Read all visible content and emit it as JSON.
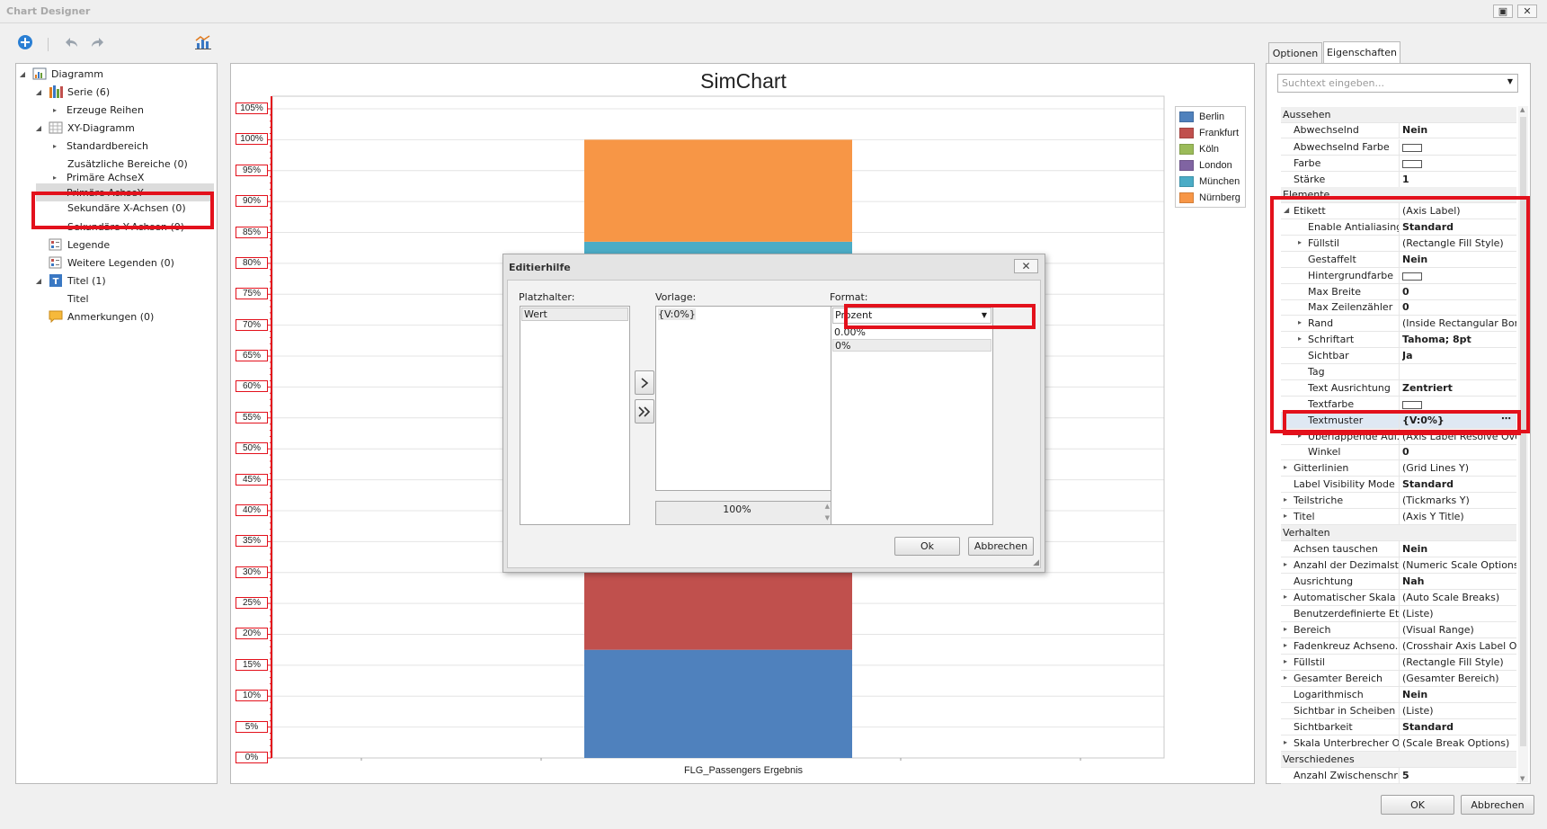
{
  "window": {
    "title": "Chart Designer"
  },
  "tree": {
    "items": [
      {
        "label": "Diagramm"
      },
      {
        "label": "Serie (6)"
      },
      {
        "label": "Erzeuge Reihen"
      },
      {
        "label": "XY-Diagramm"
      },
      {
        "label": "Standardbereich"
      },
      {
        "label": "Zusätzliche Bereiche (0)"
      },
      {
        "label": "Primäre AchseX"
      },
      {
        "label": "Primäre AchseY"
      },
      {
        "label": "Sekundäre X-Achsen (0)"
      },
      {
        "label": "Sekundäre Y-Achsen (0)"
      },
      {
        "label": "Legende"
      },
      {
        "label": "Weitere Legenden (0)"
      },
      {
        "label": "Titel (1)"
      },
      {
        "label": "Titel"
      },
      {
        "label": "Anmerkungen (0)"
      }
    ]
  },
  "chart_data": {
    "type": "bar",
    "title": "SimChart",
    "xlabel": "FLG_Passengers Ergebnis",
    "ylabel": "",
    "categories": [
      "FLG_Passengers Ergebnis"
    ],
    "stacked": true,
    "ylim": [
      0,
      105
    ],
    "yticks": [
      "0%",
      "5%",
      "10%",
      "15%",
      "20%",
      "25%",
      "30%",
      "35%",
      "40%",
      "45%",
      "50%",
      "55%",
      "60%",
      "65%",
      "70%",
      "75%",
      "80%",
      "85%",
      "90%",
      "95%",
      "100%",
      "105%"
    ],
    "series": [
      {
        "name": "Berlin",
        "color": "#4f81bd",
        "values": [
          17.5
        ]
      },
      {
        "name": "Frankfurt",
        "color": "#c0504d",
        "values": [
          12.5
        ]
      },
      {
        "name": "Köln",
        "color": "#9bbb59",
        "values": [
          0
        ]
      },
      {
        "name": "London",
        "color": "#8064a2",
        "values": [
          0
        ]
      },
      {
        "name": "München",
        "color": "#4bacc6",
        "values": [
          53.5
        ]
      },
      {
        "name": "Nürnberg",
        "color": "#f79646",
        "values": [
          16.5
        ]
      }
    ],
    "legend_position": "top-right"
  },
  "dialog": {
    "title": "Editierhilfe",
    "platzhalter_label": "Platzhalter:",
    "platzhalter_items": [
      "Wert"
    ],
    "vorlage_label": "Vorlage:",
    "vorlage_value": "{V:0%}",
    "preview_value": "100%",
    "format_label": "Format:",
    "format_selected": "Prozent",
    "format_options": [
      "0.00%",
      "0%"
    ],
    "ok_label": "Ok",
    "cancel_label": "Abbrechen"
  },
  "tabs": {
    "optionen": "Optionen",
    "eigenschaften": "Eigenschaften"
  },
  "search": {
    "placeholder": "Suchtext eingeben..."
  },
  "properties": [
    {
      "name": "Aussehen",
      "value": "",
      "type": "cat"
    },
    {
      "name": "Abwechselnd",
      "value": "Nein",
      "bold": true
    },
    {
      "name": "Abwechselnd Farbe",
      "value": "",
      "color": true
    },
    {
      "name": "Farbe",
      "value": "",
      "color": true
    },
    {
      "name": "Stärke",
      "value": "1",
      "bold": true
    },
    {
      "name": "Elemente",
      "value": "",
      "type": "cat"
    },
    {
      "name": "Etikett",
      "value": "(Axis Label)",
      "exp": "open"
    },
    {
      "name": "Enable Antialiasing",
      "value": "Standard",
      "bold": true,
      "indent": 2
    },
    {
      "name": "Füllstil",
      "value": "(Rectangle Fill Style)",
      "indent": 2,
      "exp": "closed"
    },
    {
      "name": "Gestaffelt",
      "value": "Nein",
      "bold": true,
      "indent": 2
    },
    {
      "name": "Hintergrundfarbe",
      "value": "",
      "color": true,
      "indent": 2
    },
    {
      "name": "Max Breite",
      "value": "0",
      "bold": true,
      "indent": 2
    },
    {
      "name": "Max Zeilenzähler",
      "value": "0",
      "bold": true,
      "indent": 2
    },
    {
      "name": "Rand",
      "value": "(Inside Rectangular Borde",
      "indent": 2,
      "exp": "closed"
    },
    {
      "name": "Schriftart",
      "value": "Tahoma; 8pt",
      "bold": true,
      "indent": 2,
      "exp": "closed"
    },
    {
      "name": "Sichtbar",
      "value": "Ja",
      "bold": true,
      "indent": 2
    },
    {
      "name": "Tag",
      "value": "",
      "indent": 2
    },
    {
      "name": "Text Ausrichtung",
      "value": "Zentriert",
      "bold": true,
      "indent": 2
    },
    {
      "name": "Textfarbe",
      "value": "",
      "color": true,
      "indent": 2
    },
    {
      "name": "Textmuster",
      "value": "{V:0%}",
      "bold": true,
      "indent": 2,
      "selected": true
    },
    {
      "name": "Überlappende Auf...",
      "value": "(Axis Label Resolve Over...",
      "indent": 2,
      "exp": "closed"
    },
    {
      "name": "Winkel",
      "value": "0",
      "bold": true,
      "indent": 2
    },
    {
      "name": "Gitterlinien",
      "value": "(Grid Lines Y)",
      "exp": "closed"
    },
    {
      "name": "Label Visibility Mode",
      "value": "Standard",
      "bold": true
    },
    {
      "name": "Teilstriche",
      "value": "(Tickmarks Y)",
      "exp": "closed"
    },
    {
      "name": "Titel",
      "value": "(Axis Y Title)",
      "exp": "closed"
    },
    {
      "name": "Verhalten",
      "value": "",
      "type": "cat"
    },
    {
      "name": "Achsen tauschen",
      "value": "Nein",
      "bold": true
    },
    {
      "name": "Anzahl der Dezimalst...",
      "value": "(Numeric Scale Options)",
      "exp": "closed"
    },
    {
      "name": "Ausrichtung",
      "value": "Nah",
      "bold": true
    },
    {
      "name": "Automatischer Skala ...",
      "value": "(Auto Scale Breaks)",
      "exp": "closed"
    },
    {
      "name": "Benutzerdefinierte Eti...",
      "value": "(Liste)"
    },
    {
      "name": "Bereich",
      "value": "(Visual Range)",
      "exp": "closed"
    },
    {
      "name": "Fadenkreuz Achseno...",
      "value": "(Crosshair Axis Label Opti...",
      "exp": "closed"
    },
    {
      "name": "Füllstil",
      "value": "(Rectangle Fill Style)",
      "exp": "closed"
    },
    {
      "name": "Gesamter Bereich",
      "value": "(Gesamter Bereich)",
      "exp": "closed"
    },
    {
      "name": "Logarithmisch",
      "value": "Nein",
      "bold": true
    },
    {
      "name": "Sichtbar in Scheiben",
      "value": "(Liste)"
    },
    {
      "name": "Sichtbarkeit",
      "value": "Standard",
      "bold": true
    },
    {
      "name": "Skala Unterbrecher O...",
      "value": "(Scale Break Options)",
      "exp": "closed"
    },
    {
      "name": "Verschiedenes",
      "value": "",
      "type": "cat"
    },
    {
      "name": "Anzahl Zwischenschritte",
      "value": "5",
      "bold": true
    }
  ],
  "footer": {
    "ok_label": "OK",
    "cancel_label": "Abbrechen"
  }
}
